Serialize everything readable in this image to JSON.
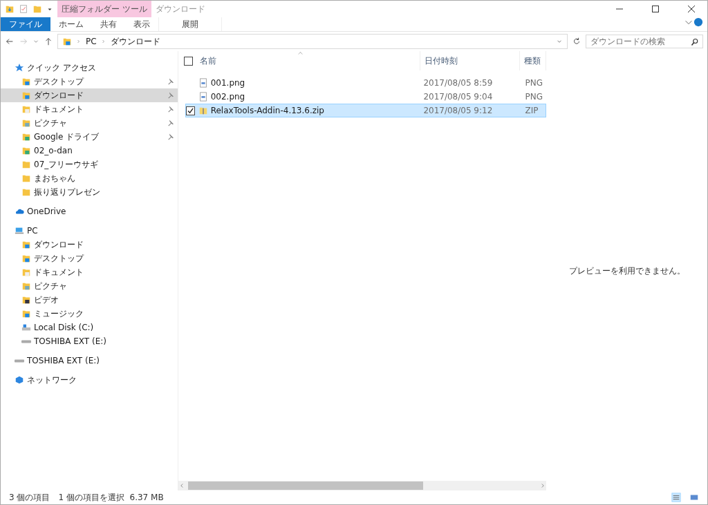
{
  "window": {
    "title": "ダウンロード",
    "context_tab": "圧縮フォルダー ツール"
  },
  "ribbon": {
    "tabs": [
      {
        "label": "ファイル",
        "kind": "file",
        "selected": true
      },
      {
        "label": "ホーム",
        "kind": "tab",
        "selected": false
      },
      {
        "label": "共有",
        "kind": "tab",
        "selected": false
      },
      {
        "label": "表示",
        "kind": "tab",
        "selected": false
      },
      {
        "label": "展開",
        "kind": "context",
        "selected": false
      }
    ]
  },
  "address": {
    "path": [
      "PC",
      "ダウンロード"
    ],
    "search_placeholder": "ダウンロードの検索"
  },
  "sidebar": {
    "items": [
      {
        "label": "クイック アクセス",
        "kind": "star",
        "selected": false,
        "children": [
          {
            "label": "デスクトップ",
            "kind": "desktop",
            "pinned": true,
            "selected": false
          },
          {
            "label": "ダウンロード",
            "kind": "download",
            "pinned": true,
            "selected": true
          },
          {
            "label": "ドキュメント",
            "kind": "document",
            "pinned": true,
            "selected": false
          },
          {
            "label": "ピクチャ",
            "kind": "picture-folder",
            "pinned": true,
            "selected": false
          },
          {
            "label": "Google ドライブ",
            "kind": "drive-folder",
            "pinned": true,
            "selected": false
          },
          {
            "label": "02_o-dan",
            "kind": "synced",
            "pinned": false,
            "selected": false
          },
          {
            "label": "07_フリーウサギ",
            "kind": "folder",
            "pinned": false,
            "selected": false
          },
          {
            "label": "まおちゃん",
            "kind": "folder",
            "pinned": false,
            "selected": false
          },
          {
            "label": "振り返りプレゼン",
            "kind": "folder",
            "pinned": false,
            "selected": false
          }
        ]
      },
      {
        "label": "OneDrive",
        "kind": "cloud",
        "selected": false
      },
      {
        "label": "PC",
        "kind": "pc",
        "selected": false,
        "children": [
          {
            "label": "ダウンロード",
            "kind": "download",
            "pinned": false,
            "selected": false
          },
          {
            "label": "デスクトップ",
            "kind": "desktop",
            "pinned": false,
            "selected": false
          },
          {
            "label": "ドキュメント",
            "kind": "document",
            "pinned": false,
            "selected": false
          },
          {
            "label": "ピクチャ",
            "kind": "picture-folder",
            "pinned": false,
            "selected": false
          },
          {
            "label": "ビデオ",
            "kind": "video",
            "pinned": false,
            "selected": false
          },
          {
            "label": "ミュージック",
            "kind": "music",
            "pinned": false,
            "selected": false
          },
          {
            "label": "Local Disk (C:)",
            "kind": "disk",
            "pinned": false,
            "selected": false
          },
          {
            "label": "TOSHIBA EXT (E:)",
            "kind": "usb",
            "pinned": false,
            "selected": false
          }
        ]
      },
      {
        "label": "TOSHIBA EXT (E:)",
        "kind": "usb",
        "selected": false
      },
      {
        "label": "ネットワーク",
        "kind": "network",
        "selected": false
      }
    ]
  },
  "table": {
    "columns": [
      "名前",
      "日付時刻",
      "種類"
    ],
    "all_checked": false,
    "rows": [
      {
        "name": "001.png",
        "kind": "image",
        "date": "2017/08/05 8:59",
        "type": "PNG",
        "selected": false
      },
      {
        "name": "002.png",
        "kind": "image",
        "date": "2017/08/05 9:04",
        "type": "PNG",
        "selected": false
      },
      {
        "name": "RelaxTools-Addin-4.13.6.zip",
        "kind": "zip",
        "date": "2017/08/05 9:12",
        "type": "ZIP",
        "selected": true
      }
    ]
  },
  "preview": {
    "message": "プレビューを利用できません。"
  },
  "status_bar": {
    "count": "3 個の項目",
    "selection": "1 個の項目を選択  6.37 MB"
  }
}
